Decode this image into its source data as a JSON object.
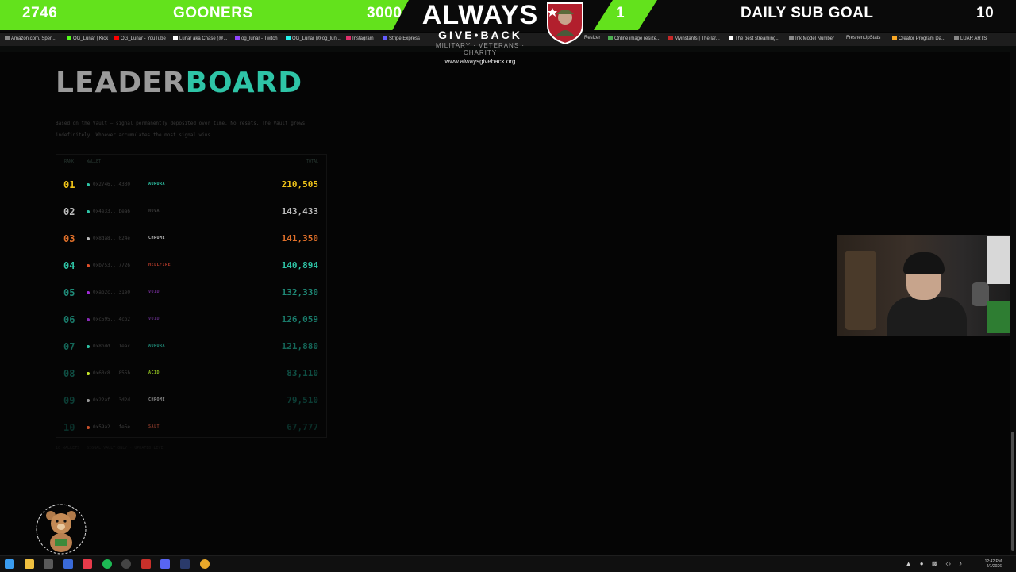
{
  "overlay": {
    "left_count": "2746",
    "left_label": "GOONERS",
    "left_goal": "3000",
    "logo_main": "ALWAYS",
    "logo_sub": "GIVE•BACK",
    "logo_tag": "MILITARY · VETERANS · CHARITY",
    "logo_url": "www.alwaysgiveback.org",
    "right_count": "1",
    "right_label": "DAILY SUB GOAL",
    "right_goal": "10",
    "accent_color": "#63e21c"
  },
  "bookmarks": [
    {
      "label": "Amazon.com. Spen...",
      "color": "#888888"
    },
    {
      "label": "OG_Lunar | Kick",
      "color": "#53fc18"
    },
    {
      "label": "OG_Lunar - YouTube",
      "color": "#ff0000"
    },
    {
      "label": "Lunar aka Chase (@...",
      "color": "#ffffff"
    },
    {
      "label": "og_lunar - Twitch",
      "color": "#9146ff"
    },
    {
      "label": "OG_Lunar (@og_lun...",
      "color": "#25f4ee"
    },
    {
      "label": "Instagram",
      "color": "#e1306c"
    },
    {
      "label": "Stripe Express",
      "color": "#635bff"
    },
    {
      "label": "Resizer",
      "color": "#888888"
    },
    {
      "label": "Online image resize...",
      "color": "#4caf50"
    },
    {
      "label": "Myinstants | The lar...",
      "color": "#c62828"
    },
    {
      "label": "The best streaming...",
      "color": "#ffffff"
    },
    {
      "label": "Ink Model Number",
      "color": "#888888"
    },
    {
      "label": "FreshenUpStats",
      "color": "#888888"
    },
    {
      "label": "Creator Program Da...",
      "color": "#f9a825"
    },
    {
      "label": "LUAR ARTS",
      "color": "#888888"
    }
  ],
  "leaderboard": {
    "title_part1": "LEADER",
    "title_part2": "BOARD",
    "description": "Based on the Vault — signal permanently deposited over time. No resets. The Vault grows indefinitely. Whoever accumulates the most signal wins.",
    "header_rank": "RANK",
    "header_wallet": "WALLET",
    "header_total": "TOTAL",
    "rows": [
      {
        "rank": "01",
        "wallet": "0x2746...4330",
        "tag": "AURORA",
        "tag_color": "#2ec4a6",
        "dot_color": "#2ec4a6",
        "total": "210,505",
        "rank_color": "#f0c419",
        "total_color": "#f0c419"
      },
      {
        "rank": "02",
        "wallet": "0x4e33...bea6",
        "tag": "NOVA",
        "tag_color": "#3a3a3a",
        "dot_color": "#2ec4a6",
        "total": "143,433",
        "rank_color": "#bdbdbd",
        "total_color": "#bdbdbd"
      },
      {
        "rank": "03",
        "wallet": "0x8da8...024e",
        "tag": "CHROME",
        "tag_color": "#bdbdbd",
        "dot_color": "#bdbdbd",
        "total": "141,350",
        "rank_color": "#e0702a",
        "total_color": "#e0702a"
      },
      {
        "rank": "04",
        "wallet": "0xb753...7726",
        "tag": "HELLFIRE",
        "tag_color": "#b33a2a",
        "dot_color": "#e0502a",
        "total": "140,894",
        "rank_color": "#2ec4a6",
        "total_color": "#2ec4a6"
      },
      {
        "rank": "05",
        "wallet": "0xab2c...31e0",
        "tag": "VOID",
        "tag_color": "#6a2a8a",
        "dot_color": "#a12ad8",
        "total": "132,330",
        "rank_color": "#1f8a78",
        "total_color": "#1f8a78"
      },
      {
        "rank": "06",
        "wallet": "0xc595...4cb2",
        "tag": "VOID",
        "tag_color": "#5a2a7a",
        "dot_color": "#8a2ab8",
        "total": "126,059",
        "rank_color": "#197a6a",
        "total_color": "#197a6a"
      },
      {
        "rank": "07",
        "wallet": "0x8bdd...1eac",
        "tag": "AURORA",
        "tag_color": "#1f8a78",
        "dot_color": "#2ec4a6",
        "total": "121,880",
        "rank_color": "#146658",
        "total_color": "#146658"
      },
      {
        "rank": "08",
        "wallet": "0x60c8...855b",
        "tag": "ACID",
        "tag_color": "#8ab81f",
        "dot_color": "#c8e82a",
        "total": "83,110",
        "rank_color": "#0f4f44",
        "total_color": "#0f4f44"
      },
      {
        "rank": "09",
        "wallet": "0x22af...3d2d",
        "tag": "CHROME",
        "tag_color": "#8a8a8a",
        "dot_color": "#9a9a9a",
        "total": "79,510",
        "rank_color": "#0c3d35",
        "total_color": "#0c3d35"
      },
      {
        "rank": "10",
        "wallet": "0x59a2...fe5e",
        "tag": "SALT",
        "tag_color": "#8a3a2a",
        "dot_color": "#c8502a",
        "total": "67,777",
        "rank_color": "#0a2f29",
        "total_color": "#0a2f29"
      }
    ],
    "footer": "10 WALLETS · SIGNAL VAULT ONLY · UPDATED LIVE"
  },
  "taskbar": {
    "time": "12:42 PM",
    "date": "4/1/2026"
  }
}
